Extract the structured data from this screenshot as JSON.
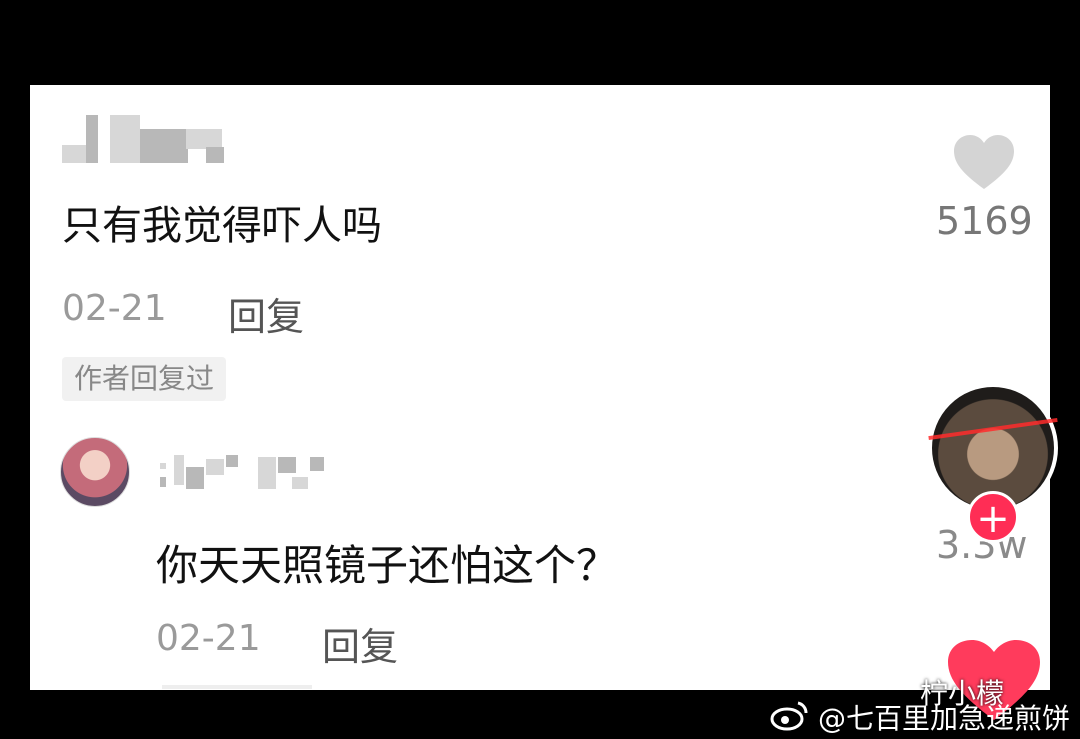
{
  "comments": [
    {
      "text": "只有我觉得吓人吗",
      "date": "02-21",
      "reply_label": "回复",
      "badge": "作者回复过",
      "likes": "5169"
    },
    {
      "text": "你天天照镜子还怕这个？",
      "date": "02-21",
      "reply_label": "回复",
      "likes": "3.3w"
    }
  ],
  "overlay": {
    "follow_plus": "+"
  },
  "watermarks": {
    "top": "柠小檬",
    "bottom": "@七百里加急递煎饼"
  },
  "colors": {
    "background": "#000000",
    "panel": "#ffffff",
    "text": "#111111",
    "muted": "#9a9a9a",
    "accent_red": "#ff2d55"
  },
  "icons": {
    "like": "heart-icon",
    "follow": "plus-icon",
    "weibo": "weibo-logo-icon"
  }
}
